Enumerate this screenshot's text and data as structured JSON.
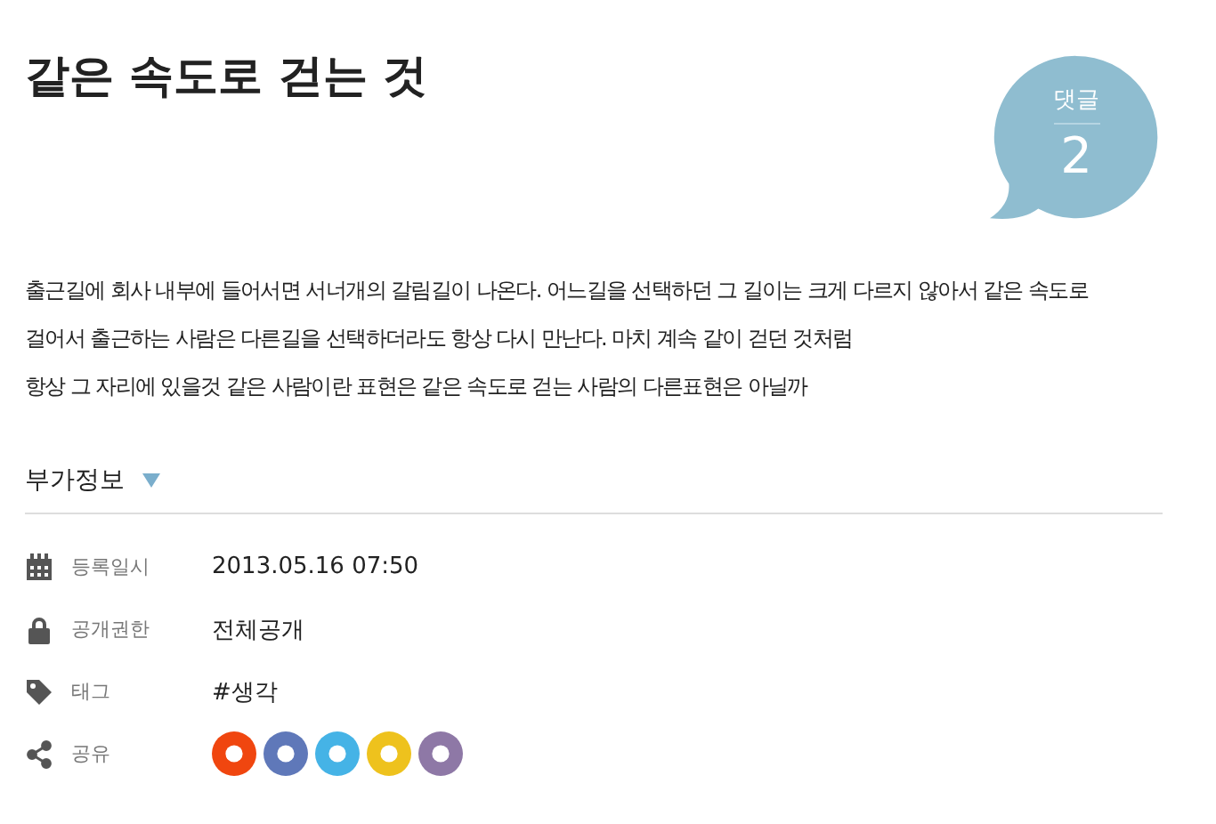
{
  "post": {
    "title": "같은 속도로 걷는 것",
    "comments": {
      "label": "댓글",
      "count": "2"
    },
    "body": [
      "출근길에 회사 내부에 들어서면 서너개의 갈림길이 나온다. 어느길을 선택하던 그 길이는 크게 다르지 않아서 같은 속도로",
      "걸어서 출근하는 사람은 다른길을 선택하더라도 항상 다시 만난다. 마치 계속 같이 걷던 것처럼",
      "항상 그 자리에 있을것 같은 사람이란 표현은 같은 속도로 걷는 사람의 다른표현은 아닐까"
    ]
  },
  "extra_info": {
    "heading": "부가정보",
    "expanded": true,
    "rows": [
      {
        "kind": "date",
        "label": "등록일시",
        "value": "2013.05.16 07:50"
      },
      {
        "kind": "privacy",
        "label": "공개권한",
        "value": "전체공개"
      },
      {
        "kind": "tag",
        "label": "태그",
        "value": "#생각"
      },
      {
        "kind": "share",
        "label": "공유"
      }
    ]
  },
  "share_buttons": [
    {
      "color": "#f0460f"
    },
    {
      "color": "#5f78b9"
    },
    {
      "color": "#45b3e6"
    },
    {
      "color": "#eec21d"
    },
    {
      "color": "#8e78a6"
    }
  ]
}
